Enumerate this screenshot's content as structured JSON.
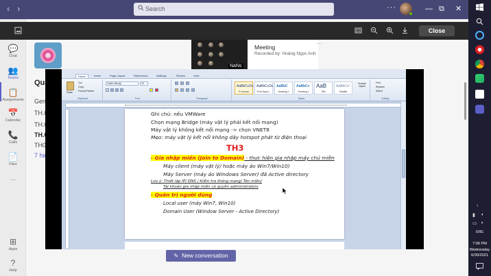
{
  "teams": {
    "search_placeholder": "Search",
    "nav_back": "‹",
    "nav_forward": "›",
    "more": "···",
    "window_min": "—",
    "window_max": "⧉",
    "window_close": "✕",
    "rail": [
      {
        "label": "Chat",
        "icon": "chat-icon",
        "glyph": "💬"
      },
      {
        "label": "Teams",
        "icon": "teams-icon",
        "glyph": "👥"
      },
      {
        "label": "Assignments",
        "icon": "assignments-icon",
        "glyph": "📋"
      },
      {
        "label": "Calendar",
        "icon": "calendar-icon",
        "glyph": "📅"
      },
      {
        "label": "Calls",
        "icon": "calls-icon",
        "glyph": "📞"
      },
      {
        "label": "Files",
        "icon": "files-icon",
        "glyph": "📄"
      },
      {
        "label": "···",
        "icon": "more-apps-icon",
        "glyph": ""
      },
      {
        "label": "Apps",
        "icon": "apps-icon",
        "glyph": "⊞"
      },
      {
        "label": "Help",
        "icon": "help-icon",
        "glyph": "?"
      }
    ],
    "channels": {
      "team_name_partial": "Qua",
      "items": [
        "Gene",
        "TH.0",
        "TH.0",
        "TH.0",
        "TH04",
        "7 hid"
      ]
    },
    "close_label": "Close",
    "meeting": {
      "title": "Meeting",
      "recorded_by": "Recorded by: Hoàng Ngọc Anh",
      "badge": "NaNs",
      "more": "···"
    },
    "new_conversation": "New conversation"
  },
  "word": {
    "tabs": [
      "Home",
      "Insert",
      "Page Layout",
      "References",
      "Mailings",
      "Review",
      "View"
    ],
    "clipboard": {
      "paste": "Paste",
      "cut": "Cut",
      "copy": "Copy",
      "format_painter": "Format Painter",
      "label": "Clipboard"
    },
    "font": {
      "name": "Calibri (Body)",
      "size": "20",
      "label": "Font"
    },
    "paragraph_label": "Paragraph",
    "styles": [
      {
        "sample": "AaBbCcDc",
        "name": "¶ Normal"
      },
      {
        "sample": "AaBbCcDc",
        "name": "¶ No Spaci..."
      },
      {
        "sample": "AaBbC",
        "name": "Heading 1"
      },
      {
        "sample": "AaBbCc",
        "name": "Heading 2"
      },
      {
        "sample": "AaB",
        "name": "Title"
      },
      {
        "sample": "AaBbCcI",
        "name": "Subtitle"
      }
    ],
    "styles_label": "Styles",
    "change_styles": "Change Styles",
    "editing": {
      "find": "Find",
      "replace": "Replace",
      "select": "Select",
      "label": "Editing"
    },
    "doc": {
      "line1": "Ghi chú: nếu VMWare",
      "line2": "Chọn mạng Bridge (máy vật lý phải kết nối mạng)",
      "line3": "Máy vật lý không kết nối mạng -> chọn VNET8",
      "line4": "Mẹo: máy vật lý kết nối không dây hotspot phát từ điện thoại",
      "heading": "TH3",
      "s1_title": "- Gia nhập miền  (Join to Domain)",
      "s1_rest": " - thực hiện gia nhập máy chủ miền",
      "s1_a": "Máy client (máy vật lý/ hoặc máy ảo Win7/Win10)",
      "s1_b": "Máy Server (máy ảo Windows Server) đã Active directory",
      "note1": "Lưu ý:  Thiết lập IP/ DNS / Kiểm tra thông mạng/ Tên miền/",
      "note2": "Tài khoản gia nhập miền có quyền administrators",
      "s2_title": "- Quản trị người dùng",
      "s2_a": "Local user (máy Win7, Win10)",
      "s2_b": "Domain User (Window Server - Active Directory)"
    }
  },
  "taskbar": {
    "time": "7:06 PM",
    "day": "Wednesday",
    "date": "6/30/2021",
    "lang": "ENG"
  },
  "colors": {
    "teams_purple": "#464775",
    "accent": "#6264a7",
    "doc_red": "#e02020",
    "highlight": "#ffff00"
  }
}
